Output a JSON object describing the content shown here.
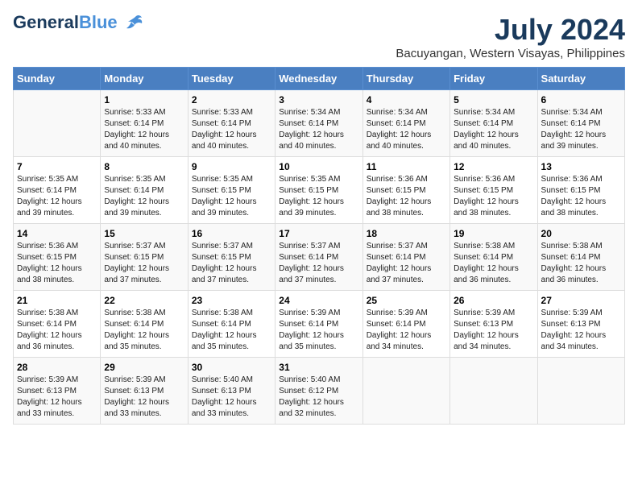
{
  "logo": {
    "general": "General",
    "blue": "Blue"
  },
  "title": "July 2024",
  "location": "Bacuyangan, Western Visayas, Philippines",
  "headers": [
    "Sunday",
    "Monday",
    "Tuesday",
    "Wednesday",
    "Thursday",
    "Friday",
    "Saturday"
  ],
  "weeks": [
    [
      {
        "day": "",
        "sunrise": "",
        "sunset": "",
        "daylight": ""
      },
      {
        "day": "1",
        "sunrise": "Sunrise: 5:33 AM",
        "sunset": "Sunset: 6:14 PM",
        "daylight": "Daylight: 12 hours and 40 minutes."
      },
      {
        "day": "2",
        "sunrise": "Sunrise: 5:33 AM",
        "sunset": "Sunset: 6:14 PM",
        "daylight": "Daylight: 12 hours and 40 minutes."
      },
      {
        "day": "3",
        "sunrise": "Sunrise: 5:34 AM",
        "sunset": "Sunset: 6:14 PM",
        "daylight": "Daylight: 12 hours and 40 minutes."
      },
      {
        "day": "4",
        "sunrise": "Sunrise: 5:34 AM",
        "sunset": "Sunset: 6:14 PM",
        "daylight": "Daylight: 12 hours and 40 minutes."
      },
      {
        "day": "5",
        "sunrise": "Sunrise: 5:34 AM",
        "sunset": "Sunset: 6:14 PM",
        "daylight": "Daylight: 12 hours and 40 minutes."
      },
      {
        "day": "6",
        "sunrise": "Sunrise: 5:34 AM",
        "sunset": "Sunset: 6:14 PM",
        "daylight": "Daylight: 12 hours and 39 minutes."
      }
    ],
    [
      {
        "day": "7",
        "sunrise": "Sunrise: 5:35 AM",
        "sunset": "Sunset: 6:14 PM",
        "daylight": "Daylight: 12 hours and 39 minutes."
      },
      {
        "day": "8",
        "sunrise": "Sunrise: 5:35 AM",
        "sunset": "Sunset: 6:14 PM",
        "daylight": "Daylight: 12 hours and 39 minutes."
      },
      {
        "day": "9",
        "sunrise": "Sunrise: 5:35 AM",
        "sunset": "Sunset: 6:15 PM",
        "daylight": "Daylight: 12 hours and 39 minutes."
      },
      {
        "day": "10",
        "sunrise": "Sunrise: 5:35 AM",
        "sunset": "Sunset: 6:15 PM",
        "daylight": "Daylight: 12 hours and 39 minutes."
      },
      {
        "day": "11",
        "sunrise": "Sunrise: 5:36 AM",
        "sunset": "Sunset: 6:15 PM",
        "daylight": "Daylight: 12 hours and 38 minutes."
      },
      {
        "day": "12",
        "sunrise": "Sunrise: 5:36 AM",
        "sunset": "Sunset: 6:15 PM",
        "daylight": "Daylight: 12 hours and 38 minutes."
      },
      {
        "day": "13",
        "sunrise": "Sunrise: 5:36 AM",
        "sunset": "Sunset: 6:15 PM",
        "daylight": "Daylight: 12 hours and 38 minutes."
      }
    ],
    [
      {
        "day": "14",
        "sunrise": "Sunrise: 5:36 AM",
        "sunset": "Sunset: 6:15 PM",
        "daylight": "Daylight: 12 hours and 38 minutes."
      },
      {
        "day": "15",
        "sunrise": "Sunrise: 5:37 AM",
        "sunset": "Sunset: 6:15 PM",
        "daylight": "Daylight: 12 hours and 37 minutes."
      },
      {
        "day": "16",
        "sunrise": "Sunrise: 5:37 AM",
        "sunset": "Sunset: 6:15 PM",
        "daylight": "Daylight: 12 hours and 37 minutes."
      },
      {
        "day": "17",
        "sunrise": "Sunrise: 5:37 AM",
        "sunset": "Sunset: 6:14 PM",
        "daylight": "Daylight: 12 hours and 37 minutes."
      },
      {
        "day": "18",
        "sunrise": "Sunrise: 5:37 AM",
        "sunset": "Sunset: 6:14 PM",
        "daylight": "Daylight: 12 hours and 37 minutes."
      },
      {
        "day": "19",
        "sunrise": "Sunrise: 5:38 AM",
        "sunset": "Sunset: 6:14 PM",
        "daylight": "Daylight: 12 hours and 36 minutes."
      },
      {
        "day": "20",
        "sunrise": "Sunrise: 5:38 AM",
        "sunset": "Sunset: 6:14 PM",
        "daylight": "Daylight: 12 hours and 36 minutes."
      }
    ],
    [
      {
        "day": "21",
        "sunrise": "Sunrise: 5:38 AM",
        "sunset": "Sunset: 6:14 PM",
        "daylight": "Daylight: 12 hours and 36 minutes."
      },
      {
        "day": "22",
        "sunrise": "Sunrise: 5:38 AM",
        "sunset": "Sunset: 6:14 PM",
        "daylight": "Daylight: 12 hours and 35 minutes."
      },
      {
        "day": "23",
        "sunrise": "Sunrise: 5:38 AM",
        "sunset": "Sunset: 6:14 PM",
        "daylight": "Daylight: 12 hours and 35 minutes."
      },
      {
        "day": "24",
        "sunrise": "Sunrise: 5:39 AM",
        "sunset": "Sunset: 6:14 PM",
        "daylight": "Daylight: 12 hours and 35 minutes."
      },
      {
        "day": "25",
        "sunrise": "Sunrise: 5:39 AM",
        "sunset": "Sunset: 6:14 PM",
        "daylight": "Daylight: 12 hours and 34 minutes."
      },
      {
        "day": "26",
        "sunrise": "Sunrise: 5:39 AM",
        "sunset": "Sunset: 6:13 PM",
        "daylight": "Daylight: 12 hours and 34 minutes."
      },
      {
        "day": "27",
        "sunrise": "Sunrise: 5:39 AM",
        "sunset": "Sunset: 6:13 PM",
        "daylight": "Daylight: 12 hours and 34 minutes."
      }
    ],
    [
      {
        "day": "28",
        "sunrise": "Sunrise: 5:39 AM",
        "sunset": "Sunset: 6:13 PM",
        "daylight": "Daylight: 12 hours and 33 minutes."
      },
      {
        "day": "29",
        "sunrise": "Sunrise: 5:39 AM",
        "sunset": "Sunset: 6:13 PM",
        "daylight": "Daylight: 12 hours and 33 minutes."
      },
      {
        "day": "30",
        "sunrise": "Sunrise: 5:40 AM",
        "sunset": "Sunset: 6:13 PM",
        "daylight": "Daylight: 12 hours and 33 minutes."
      },
      {
        "day": "31",
        "sunrise": "Sunrise: 5:40 AM",
        "sunset": "Sunset: 6:12 PM",
        "daylight": "Daylight: 12 hours and 32 minutes."
      },
      {
        "day": "",
        "sunrise": "",
        "sunset": "",
        "daylight": ""
      },
      {
        "day": "",
        "sunrise": "",
        "sunset": "",
        "daylight": ""
      },
      {
        "day": "",
        "sunrise": "",
        "sunset": "",
        "daylight": ""
      }
    ]
  ]
}
